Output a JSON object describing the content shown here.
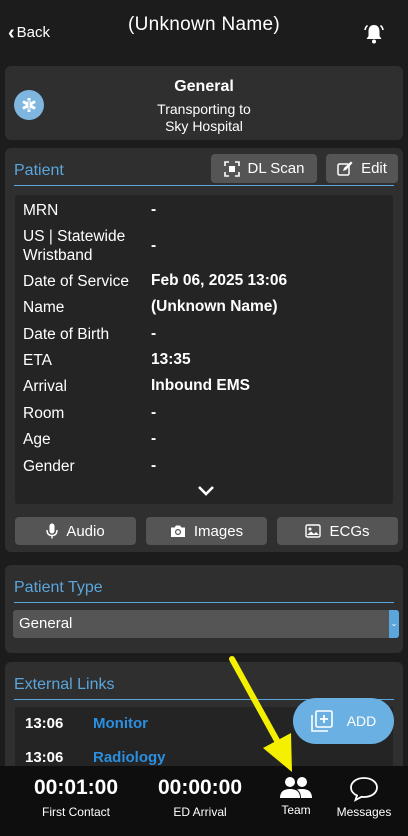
{
  "header": {
    "back_label": "Back",
    "title": "(Unknown Name)"
  },
  "general": {
    "title": "General",
    "subtitle_line1": "Transporting to",
    "subtitle_line2": "Sky Hospital"
  },
  "patient": {
    "heading": "Patient",
    "dl_scan_label": "DL Scan",
    "edit_label": "Edit",
    "rows": [
      {
        "label": "MRN",
        "value": "-"
      },
      {
        "label": "US | Statewide Wristband",
        "value": "-"
      },
      {
        "label": "Date of Service",
        "value": "Feb 06, 2025 13:06"
      },
      {
        "label": "Name",
        "value": "(Unknown Name)"
      },
      {
        "label": "Date of Birth",
        "value": "-"
      },
      {
        "label": "ETA",
        "value": "13:35"
      },
      {
        "label": "Arrival",
        "value": "Inbound EMS"
      },
      {
        "label": "Room",
        "value": "-"
      },
      {
        "label": "Age",
        "value": "-"
      },
      {
        "label": "Gender",
        "value": "-"
      }
    ],
    "audio_label": "Audio",
    "images_label": "Images",
    "ecgs_label": "ECGs"
  },
  "patient_type": {
    "heading": "Patient Type",
    "selected": "General"
  },
  "external_links": {
    "heading": "External Links",
    "items": [
      {
        "time": "13:06",
        "name": "Monitor"
      },
      {
        "time": "13:06",
        "name": "Radiology"
      }
    ]
  },
  "add_button_label": "ADD",
  "bottom": {
    "first_contact_time": "00:01:00",
    "first_contact_label": "First Contact",
    "ed_arrival_time": "00:00:00",
    "ed_arrival_label": "ED Arrival",
    "team_label": "Team",
    "messages_label": "Messages"
  },
  "colors": {
    "accent": "#5aa6dc",
    "link": "#2b8fe0",
    "annotation_arrow": "#f5f000"
  },
  "icons": [
    "chevron-left-icon",
    "bell-alert-icon",
    "star-of-life-icon",
    "scan-icon",
    "edit-icon",
    "microphone-icon",
    "camera-icon",
    "ecg-image-icon",
    "chevron-down-icon",
    "add-image-icon",
    "team-icon",
    "messages-icon"
  ]
}
